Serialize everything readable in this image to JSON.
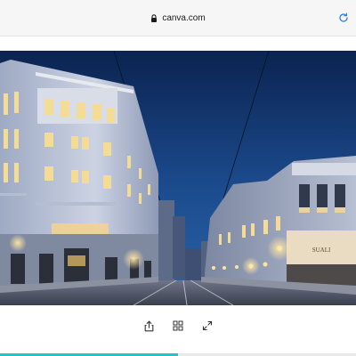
{
  "browser": {
    "url": "canva.com",
    "lock_icon": "lock-icon",
    "reload_icon": "reload-icon"
  },
  "photo": {
    "storefront_sign": "SUALI",
    "colors": {
      "sky": "#1c4c8f",
      "facade": "#ccd3e3",
      "window_glow": "#f4dc96"
    }
  },
  "toolbar": {
    "share_icon": "share-icon",
    "grid_icon": "grid-icon",
    "expand_icon": "expand-icon"
  },
  "progress": {
    "fraction": 0.5,
    "color": "#20c4cb"
  }
}
